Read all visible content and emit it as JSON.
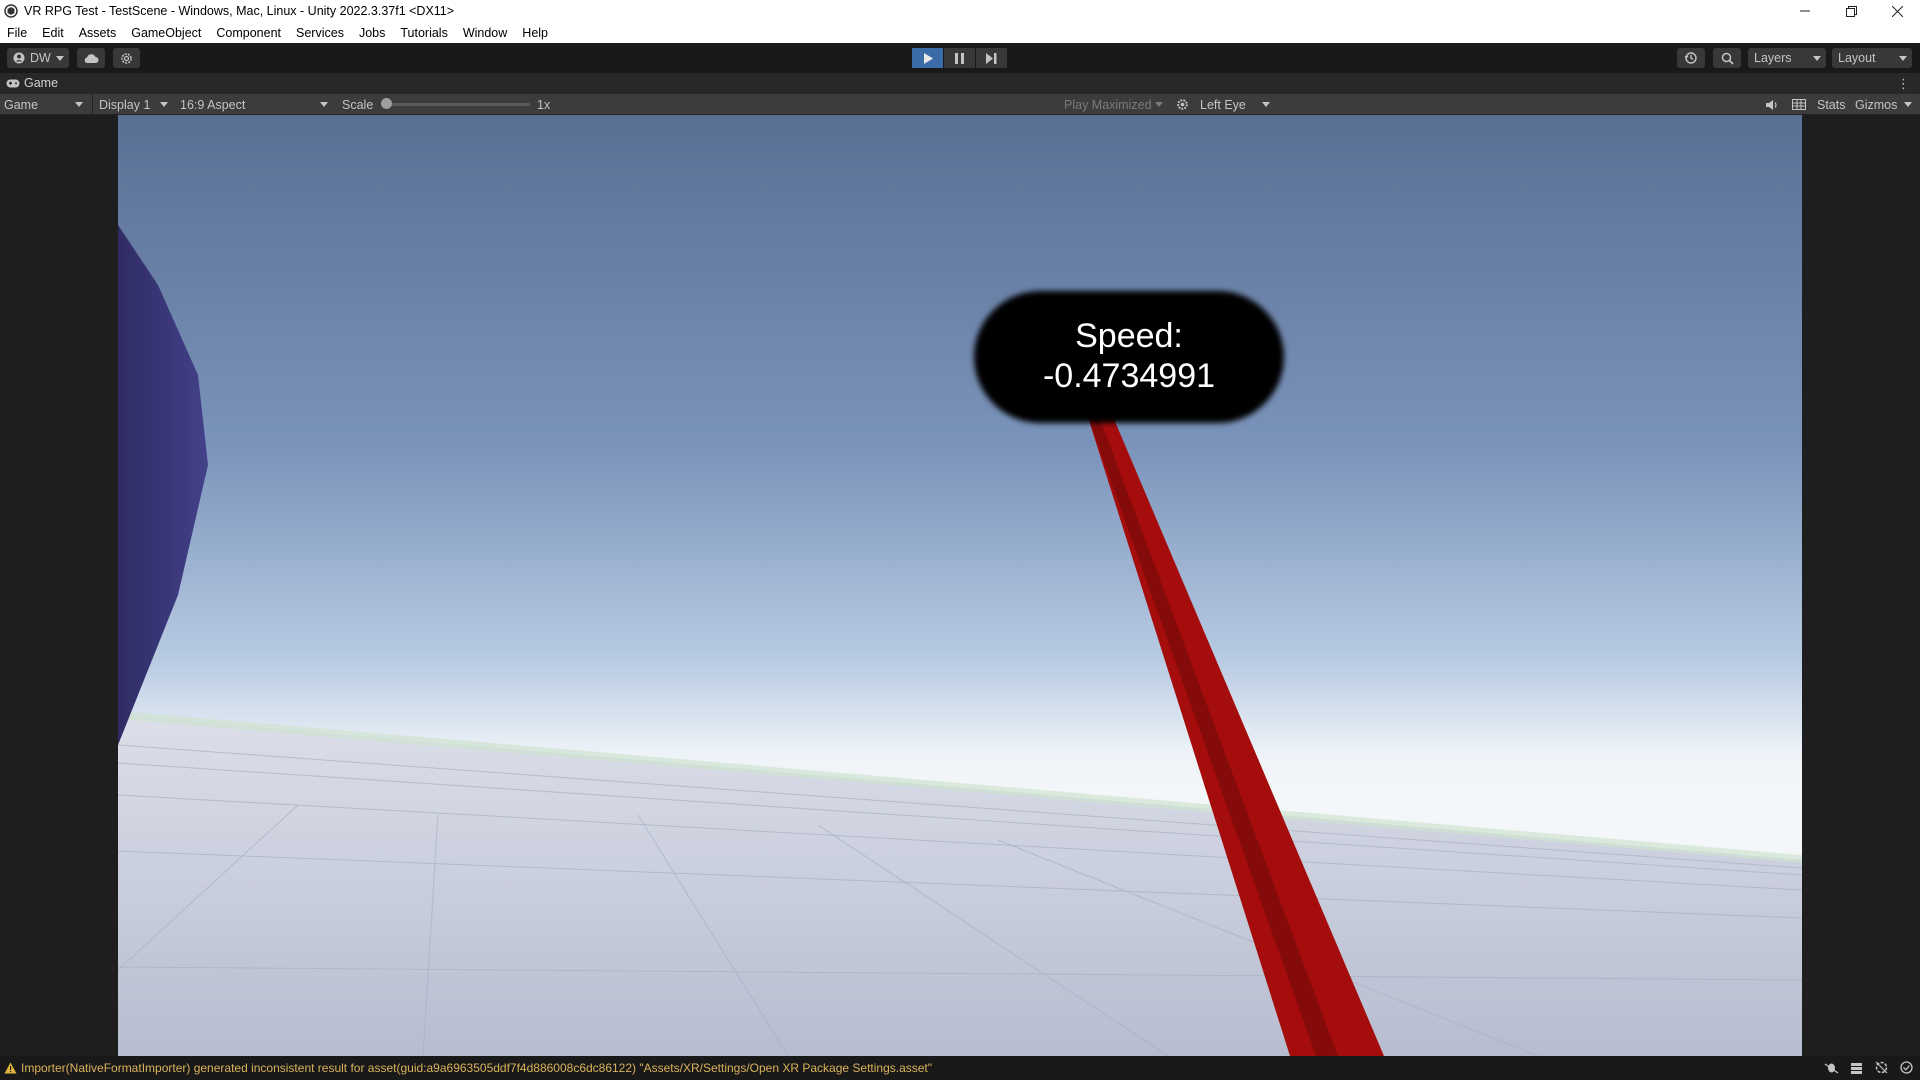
{
  "window": {
    "title": "VR RPG Test - TestScene - Windows, Mac, Linux - Unity 2022.3.37f1 <DX11>"
  },
  "menu": [
    "File",
    "Edit",
    "Assets",
    "GameObject",
    "Component",
    "Services",
    "Jobs",
    "Tutorials",
    "Window",
    "Help"
  ],
  "toolbar": {
    "account_label": "DW",
    "layers_label": "Layers",
    "layout_label": "Layout"
  },
  "tab": {
    "label": "Game"
  },
  "game_toolbar": {
    "view_mode": "Game",
    "display": "Display 1",
    "aspect": "16:9 Aspect",
    "scale_label": "Scale",
    "scale_value": "1x",
    "scale_fraction": 0.0,
    "play_mode": "Play Maximized",
    "eye": "Left Eye",
    "stats_label": "Stats",
    "gizmos_label": "Gizmos"
  },
  "scene": {
    "speed_line1": "Speed:",
    "speed_line2": "-0.4734991"
  },
  "status": {
    "message": "Importer(NativeFormatImporter) generated inconsistent result for asset(guid:a9a6963505ddf7f4d886008c6dc86122) \"Assets/XR/Settings/Open XR Package Settings.asset\""
  },
  "colors": {
    "accent_play": "#3b6ca8",
    "warning": "#d9b25a",
    "stick_red": "#a50d0d"
  }
}
